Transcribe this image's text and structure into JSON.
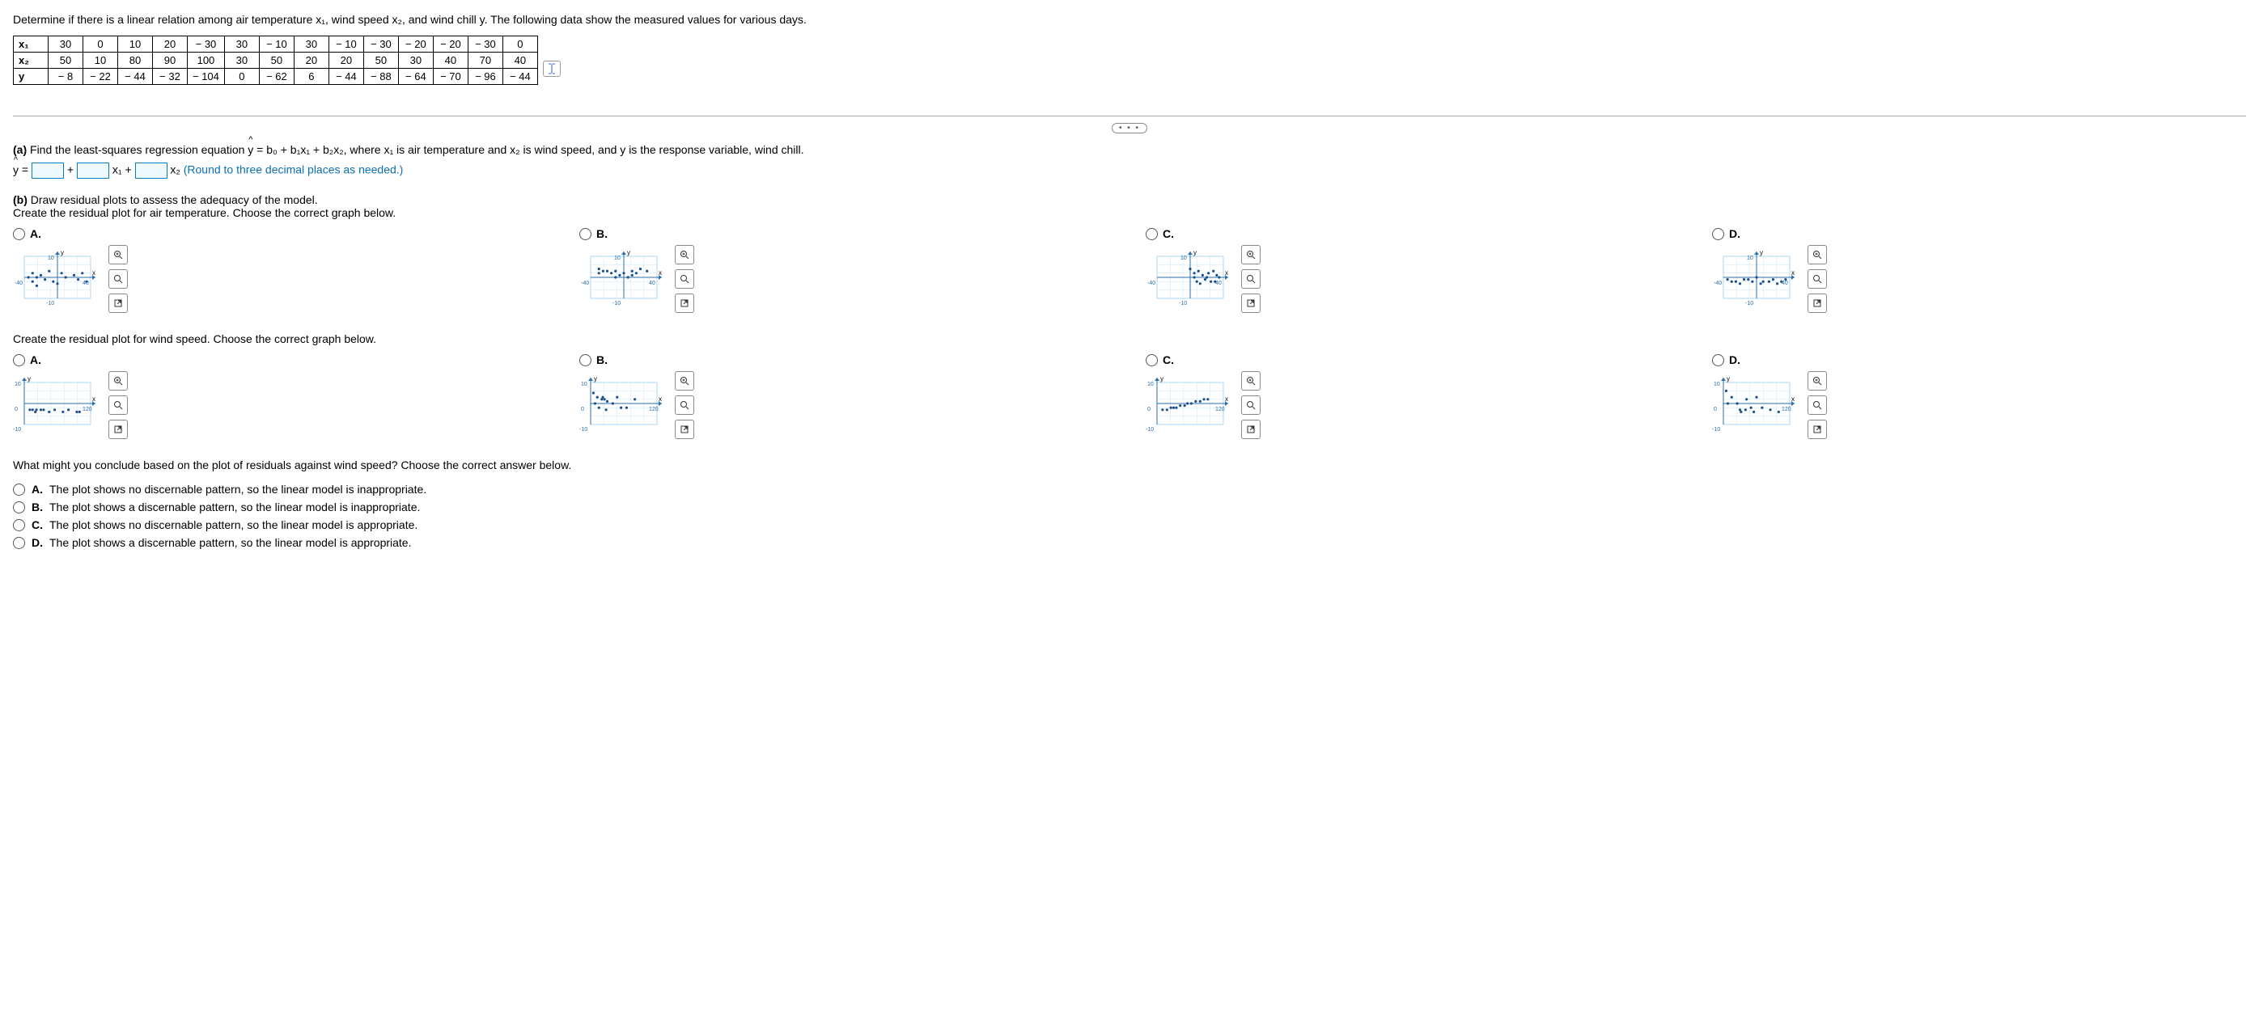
{
  "intro": "Determine if there is a linear relation among air temperature x₁, wind speed x₂, and wind chill y. The following data show the measured values for various days.",
  "table": {
    "rows": [
      {
        "label": "x₁",
        "cells": [
          "30",
          "0",
          "10",
          "20",
          "− 30",
          "30",
          "− 10",
          "30",
          "− 10",
          "− 30",
          "− 20",
          "− 20",
          "− 30",
          "0"
        ]
      },
      {
        "label": "x₂",
        "cells": [
          "50",
          "10",
          "80",
          "90",
          "100",
          "30",
          "50",
          "20",
          "20",
          "50",
          "30",
          "40",
          "70",
          "40"
        ]
      },
      {
        "label": "y",
        "cells": [
          "− 8",
          "− 22",
          "− 44",
          "− 32",
          "− 104",
          "0",
          "− 62",
          "6",
          "− 44",
          "− 88",
          "− 64",
          "− 70",
          "− 96",
          "− 44"
        ]
      }
    ]
  },
  "partA": {
    "prefix": "(a)",
    "text": " Find the least-squares regression equation ",
    "eq_desc": " = b₀ + b₁x₁ + b₂x₂, where x₁ is air temperature and x₂ is wind speed, and y is the response variable, wind chill.",
    "line_prefix": " = ",
    "plus": " + ",
    "x1": "x₁ + ",
    "x2": "x₂ ",
    "round": "(Round to three decimal places as needed.)"
  },
  "partB": {
    "prefix": "(b)",
    "text": " Draw residual plots to assess the adequacy of the model.",
    "sub1": "Create the residual plot for air temperature. Choose the correct graph below.",
    "sub2": "Create the residual plot for wind speed. Choose the correct graph below."
  },
  "opt_labels": {
    "a": "A.",
    "b": "B.",
    "c": "C.",
    "d": "D."
  },
  "axis": {
    "y": "y",
    "x": "x"
  },
  "ticks1": {
    "ytop": "10",
    "ybot": "-10",
    "xleft": "-40",
    "xright": "40"
  },
  "ticks2": {
    "ytop": "10",
    "ybot": "-10",
    "xleft": "0",
    "xright": "120"
  },
  "final_q": "What might you conclude based on the plot of residuals against wind speed? Choose the correct answer below.",
  "answers": {
    "a": "The plot shows no discernable pattern, so the linear model is inappropriate.",
    "b": "The plot shows a discernable pattern, so the linear model is inappropriate.",
    "c": "The plot shows no discernable pattern, so the linear model is appropriate.",
    "d": "The plot shows a discernable pattern, so the linear model is appropriate."
  },
  "chart_data": [
    {
      "id": "temp-A",
      "type": "scatter",
      "title": "Residuals vs Air Temperature – Option A",
      "xlabel": "x",
      "ylabel": "y",
      "xlim": [
        -40,
        40
      ],
      "ylim": [
        -10,
        10
      ],
      "points": [
        [
          -35,
          0
        ],
        [
          -30,
          -2
        ],
        [
          -30,
          2
        ],
        [
          -25,
          -4
        ],
        [
          -25,
          0
        ],
        [
          -20,
          1
        ],
        [
          -15,
          -1
        ],
        [
          -10,
          3
        ],
        [
          -5,
          -2
        ],
        [
          0,
          -3
        ],
        [
          5,
          2
        ],
        [
          10,
          0
        ],
        [
          20,
          1
        ],
        [
          25,
          -1
        ],
        [
          30,
          2
        ],
        [
          35,
          -2
        ]
      ]
    },
    {
      "id": "temp-B",
      "type": "scatter",
      "title": "Residuals vs Air Temperature – Option B",
      "xlabel": "x",
      "ylabel": "y",
      "xlim": [
        -40,
        40
      ],
      "ylim": [
        -10,
        10
      ],
      "points": [
        [
          -30,
          4
        ],
        [
          -30,
          2
        ],
        [
          -25,
          3
        ],
        [
          -20,
          3
        ],
        [
          -15,
          2
        ],
        [
          -10,
          3
        ],
        [
          -10,
          0
        ],
        [
          -5,
          1
        ],
        [
          0,
          2
        ],
        [
          5,
          0
        ],
        [
          10,
          3
        ],
        [
          10,
          1
        ],
        [
          15,
          2
        ],
        [
          20,
          4
        ],
        [
          28,
          3
        ]
      ]
    },
    {
      "id": "temp-C",
      "type": "scatter",
      "title": "Residuals vs Air Temperature – Option C",
      "xlabel": "x",
      "ylabel": "y",
      "xlim": [
        -40,
        40
      ],
      "ylim": [
        -10,
        10
      ],
      "points": [
        [
          0,
          4
        ],
        [
          5,
          0
        ],
        [
          5,
          2
        ],
        [
          8,
          -2
        ],
        [
          10,
          3
        ],
        [
          12,
          -3
        ],
        [
          15,
          1
        ],
        [
          18,
          -1
        ],
        [
          20,
          0
        ],
        [
          22,
          2
        ],
        [
          25,
          -2
        ],
        [
          28,
          3
        ],
        [
          30,
          -2
        ],
        [
          32,
          1
        ],
        [
          35,
          0
        ]
      ]
    },
    {
      "id": "temp-D",
      "type": "scatter",
      "title": "Residuals vs Air Temperature – Option D",
      "xlabel": "x",
      "ylabel": "y",
      "xlim": [
        -40,
        40
      ],
      "ylim": [
        -10,
        10
      ],
      "points": [
        [
          -35,
          -1
        ],
        [
          -30,
          -2
        ],
        [
          -25,
          -2
        ],
        [
          -20,
          -3
        ],
        [
          -15,
          -1
        ],
        [
          -10,
          -1
        ],
        [
          -5,
          -2
        ],
        [
          0,
          0
        ],
        [
          5,
          -3
        ],
        [
          8,
          -2
        ],
        [
          15,
          -2
        ],
        [
          20,
          -1
        ],
        [
          25,
          -3
        ],
        [
          30,
          -2
        ],
        [
          35,
          -1
        ]
      ]
    },
    {
      "id": "wind-A",
      "type": "scatter",
      "title": "Residuals vs Wind Speed – Option A",
      "xlabel": "x",
      "ylabel": "y",
      "xlim": [
        0,
        120
      ],
      "ylim": [
        -10,
        10
      ],
      "points": [
        [
          10,
          -3
        ],
        [
          15,
          -3
        ],
        [
          20,
          -4
        ],
        [
          22,
          -3
        ],
        [
          30,
          -3
        ],
        [
          35,
          -3
        ],
        [
          45,
          -4
        ],
        [
          55,
          -3
        ],
        [
          70,
          -4
        ],
        [
          80,
          -3
        ],
        [
          95,
          -4
        ],
        [
          100,
          -4
        ]
      ]
    },
    {
      "id": "wind-B",
      "type": "scatter",
      "title": "Residuals vs Wind Speed – Option B",
      "xlabel": "x",
      "ylabel": "y",
      "xlim": [
        0,
        120
      ],
      "ylim": [
        -10,
        10
      ],
      "points": [
        [
          5,
          5
        ],
        [
          8,
          0
        ],
        [
          12,
          3
        ],
        [
          15,
          -2
        ],
        [
          20,
          2
        ],
        [
          22,
          3
        ],
        [
          25,
          2
        ],
        [
          28,
          -3
        ],
        [
          30,
          1
        ],
        [
          40,
          0
        ],
        [
          48,
          3
        ],
        [
          55,
          -2
        ],
        [
          65,
          -2
        ],
        [
          80,
          2
        ]
      ]
    },
    {
      "id": "wind-C",
      "type": "scatter",
      "title": "Residuals vs Wind Speed – Option C",
      "xlabel": "x",
      "ylabel": "y",
      "xlim": [
        0,
        120
      ],
      "ylim": [
        -10,
        10
      ],
      "points": [
        [
          10,
          -3
        ],
        [
          18,
          -3
        ],
        [
          25,
          -2
        ],
        [
          30,
          -2
        ],
        [
          35,
          -2
        ],
        [
          42,
          -1
        ],
        [
          50,
          -1
        ],
        [
          55,
          0
        ],
        [
          62,
          0
        ],
        [
          70,
          1
        ],
        [
          78,
          1
        ],
        [
          85,
          2
        ],
        [
          92,
          2
        ]
      ]
    },
    {
      "id": "wind-D",
      "type": "scatter",
      "title": "Residuals vs Wind Speed – Option D",
      "xlabel": "x",
      "ylabel": "y",
      "xlim": [
        0,
        120
      ],
      "ylim": [
        -10,
        10
      ],
      "points": [
        [
          5,
          6
        ],
        [
          8,
          0
        ],
        [
          15,
          3
        ],
        [
          25,
          0
        ],
        [
          30,
          -3
        ],
        [
          32,
          -4
        ],
        [
          40,
          -3
        ],
        [
          42,
          2
        ],
        [
          50,
          -2
        ],
        [
          55,
          -4
        ],
        [
          60,
          3
        ],
        [
          70,
          -2
        ],
        [
          85,
          -3
        ],
        [
          100,
          -4
        ]
      ]
    }
  ]
}
